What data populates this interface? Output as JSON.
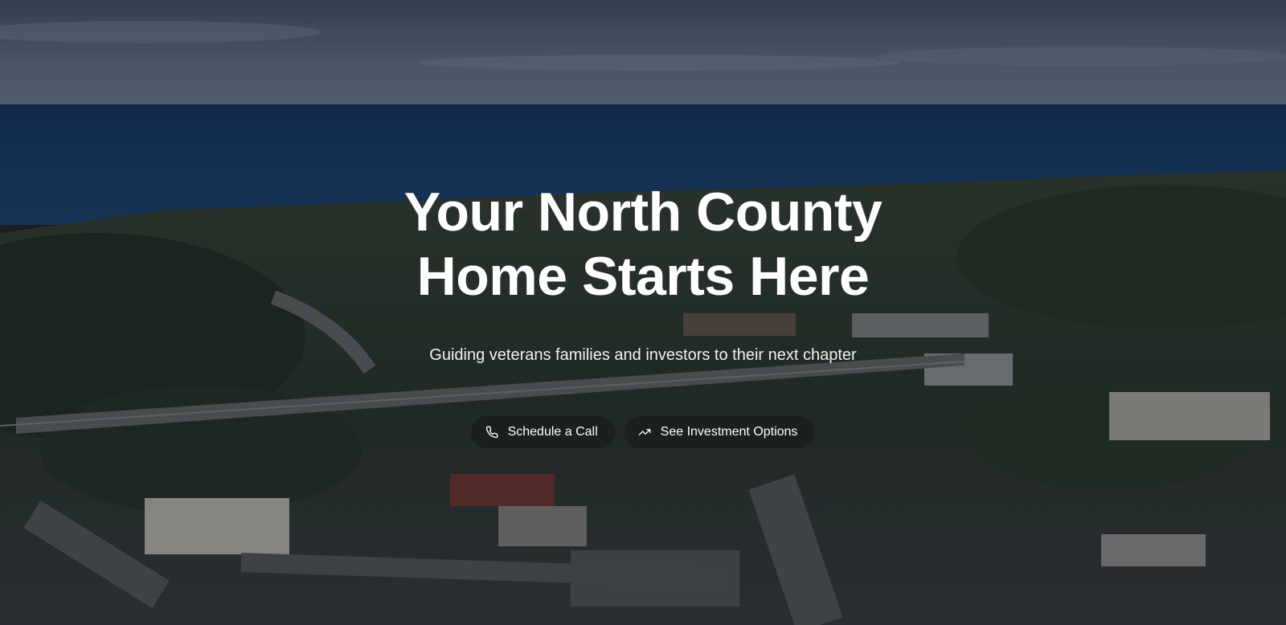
{
  "hero": {
    "headline_line1": "Your North County",
    "headline_line2": "Home Starts Here",
    "subheadline": "Guiding veterans families and investors to their next chapter",
    "background_image": "aerial-coastal-town-photo"
  },
  "ctas": [
    {
      "label": "Schedule a Call",
      "icon": "phone-icon"
    },
    {
      "label": "See Investment Options",
      "icon": "trending-up-icon"
    }
  ],
  "colors": {
    "text": "#ffffff",
    "button_bg": "rgba(20,22,26,0.55)",
    "ocean": "#1b3f72",
    "sky": "#5d6f88"
  }
}
